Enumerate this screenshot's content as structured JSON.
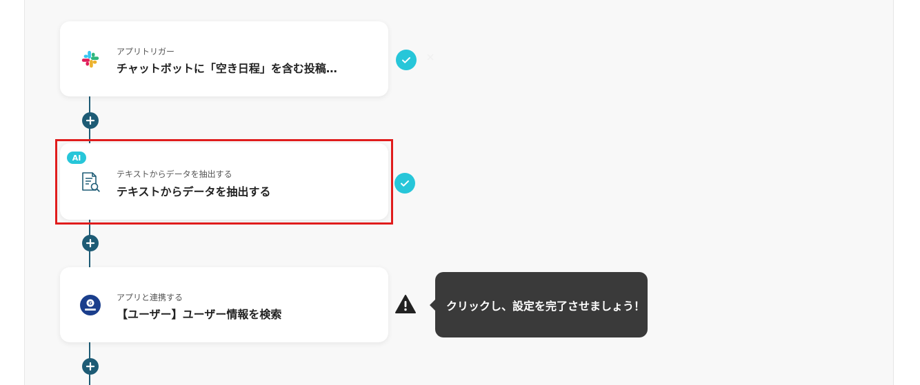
{
  "flow": {
    "steps": [
      {
        "subtitle": "アプリトリガー",
        "title": "チャットボットに「空き日程」を含む投稿…",
        "icon": "slack-icon",
        "status": "complete"
      },
      {
        "badge": "AI",
        "subtitle": "テキストからデータを抽出する",
        "title": "テキストからデータを抽出する",
        "icon": "document-search-icon",
        "status": "complete"
      },
      {
        "subtitle": "アプリと連携する",
        "title": "【ユーザー】ユーザー情報を検索",
        "icon": "garoon-icon",
        "status": "warning"
      }
    ],
    "tooltip": "クリックし、設定を完了させましょう！"
  },
  "colors": {
    "connector": "#1d5b75",
    "check": "#27c6d9",
    "highlight": "#e01c1c",
    "tooltip_bg": "#3a3a3a"
  }
}
